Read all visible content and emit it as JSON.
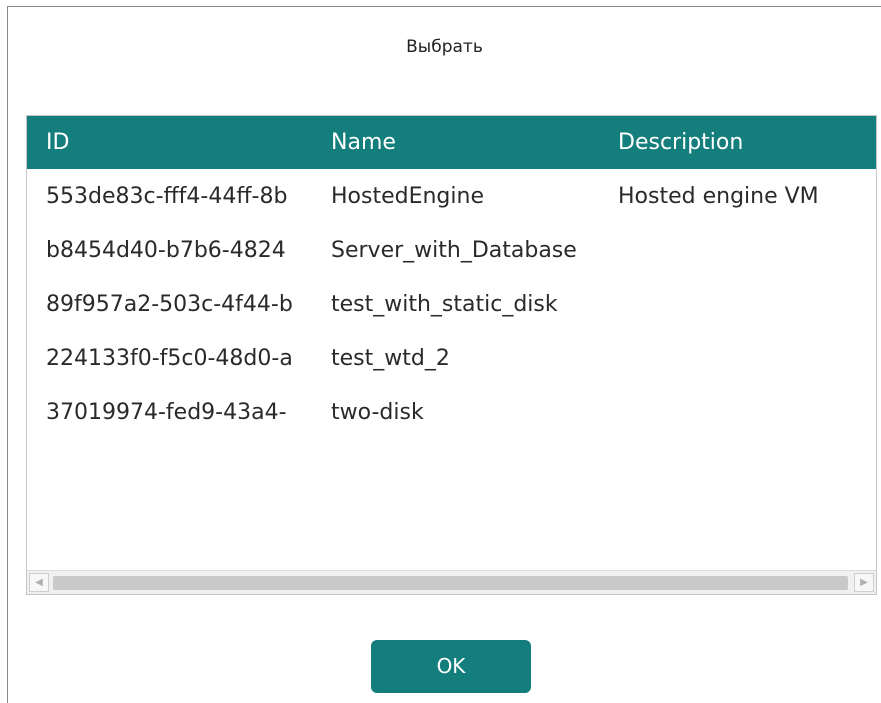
{
  "dialog": {
    "title": "Выбрать",
    "ok_label": "OK"
  },
  "table": {
    "columns": [
      "ID",
      "Name",
      "Description"
    ],
    "rows": [
      {
        "id": "553de83c-fff4-44ff-8b",
        "name": "HostedEngine",
        "description": "Hosted engine VM"
      },
      {
        "id": "b8454d40-b7b6-4824",
        "name": "Server_with_Database",
        "description": ""
      },
      {
        "id": "89f957a2-503c-4f44-b",
        "name": "test_with_static_disk",
        "description": ""
      },
      {
        "id": "224133f0-f5c0-48d0-a",
        "name": "test_wtd_2",
        "description": ""
      },
      {
        "id": "37019974-fed9-43a4-",
        "name": "two-disk",
        "description": ""
      }
    ]
  },
  "colors": {
    "accent": "#147e7c",
    "header_text": "#ffffff",
    "cell_text": "#2a2a2a"
  },
  "icons": {
    "scroll_left": "scroll-left-arrow-icon",
    "scroll_right": "scroll-right-arrow-icon"
  }
}
